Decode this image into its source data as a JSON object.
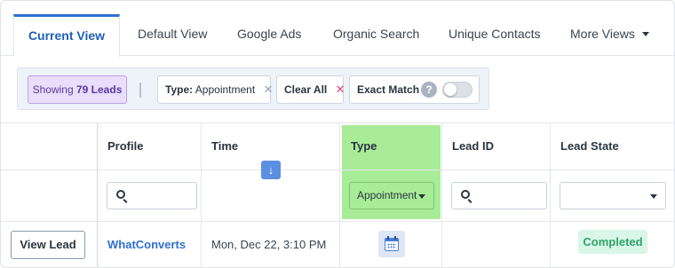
{
  "tabs": [
    {
      "label": "Current View",
      "active": true
    },
    {
      "label": "Default View"
    },
    {
      "label": "Google Ads"
    },
    {
      "label": "Organic Search"
    },
    {
      "label": "Unique Contacts"
    },
    {
      "label": "More Views"
    }
  ],
  "filters": {
    "count_prefix": "Showing",
    "count_value": "79 Leads",
    "type_label": "Type:",
    "type_value": "Appointment",
    "remove_glyph": "✕",
    "clear_label": "Clear All",
    "clear_glyph": "✕",
    "exact_label": "Exact Match",
    "help_glyph": "?",
    "exact_enabled": false
  },
  "table": {
    "columns": [
      "Profile",
      "Time",
      "Type",
      "Lead ID",
      "Lead State"
    ],
    "sort_glyph": "↓",
    "type_filter_value": "Appointment",
    "lead_state_filter_value": "",
    "rows": [
      {
        "action": "View Lead",
        "profile": "WhatConverts",
        "time": "Mon, Dec 22, 3:10 PM",
        "type_icon": "calendar-icon",
        "lead_id": "",
        "lead_state": "Completed"
      }
    ]
  },
  "colors": {
    "accent": "#2e6fd0",
    "type_highlight": "#a8ec98",
    "count_chip": "#e9defb",
    "completed_badge": "#d9f7e8",
    "clear_x": "#e0467a"
  }
}
